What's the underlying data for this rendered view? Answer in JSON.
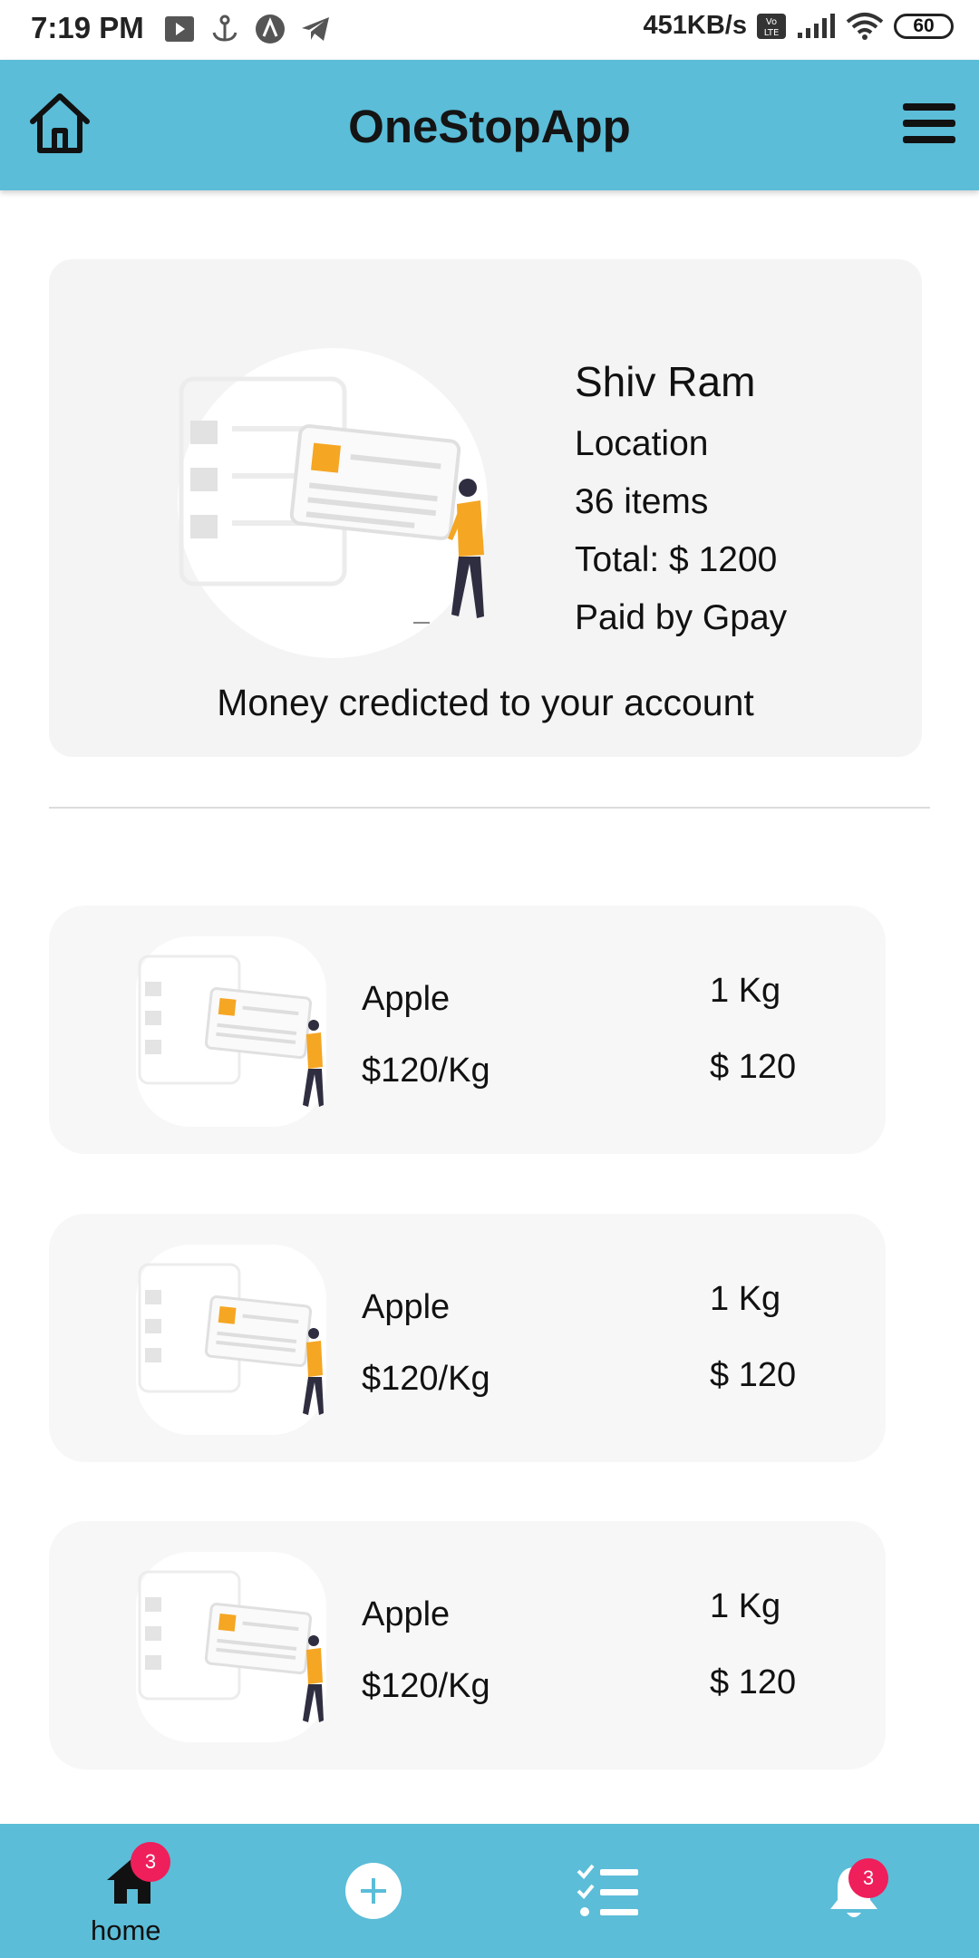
{
  "status_bar": {
    "time": "7:19 PM",
    "speed": "451KB/s",
    "battery": "60",
    "icons": [
      "screen-record-icon",
      "anchor-icon",
      "app-icon",
      "telegram-icon",
      "volte-icon",
      "signal-icon",
      "wifi-icon",
      "battery-icon"
    ]
  },
  "app_bar": {
    "title": "OneStopApp",
    "left_icon": "home-icon",
    "right_icon": "hamburger-menu-icon"
  },
  "summary": {
    "name": "Shiv Ram",
    "location": "Location",
    "items": "36 items",
    "total": "Total: $ 1200",
    "payment": "Paid by Gpay",
    "message": "Money credicted to your account"
  },
  "items": [
    {
      "name": "Apple",
      "rate": "$120/Kg",
      "qty": "1 Kg",
      "price": "$ 120"
    },
    {
      "name": "Apple",
      "rate": "$120/Kg",
      "qty": "1 Kg",
      "price": "$ 120"
    },
    {
      "name": "Apple",
      "rate": "$120/Kg",
      "qty": "1 Kg",
      "price": "$ 120"
    }
  ],
  "bottom_nav": {
    "home_label": "home",
    "home_badge": "3",
    "notif_badge": "3"
  },
  "colors": {
    "accent": "#5bbdd8",
    "badge": "#ee1f5a",
    "illustration_orange": "#f5a623"
  }
}
